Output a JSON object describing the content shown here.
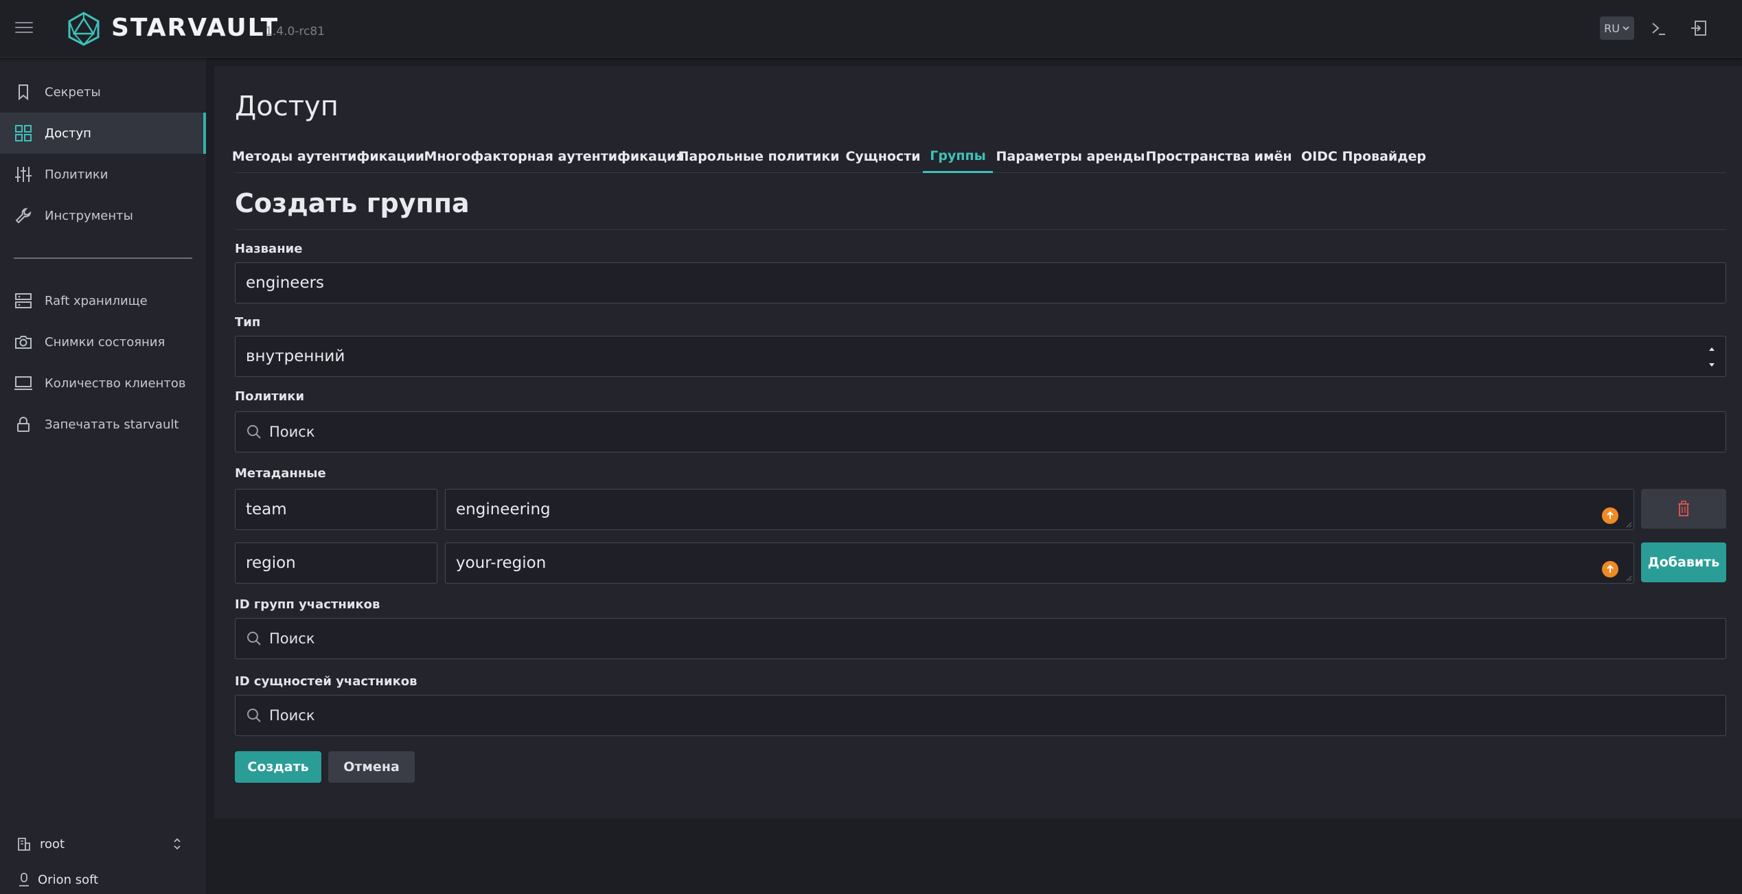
{
  "header": {
    "brand": "STARVAULT",
    "version": "1.4.0-rc81",
    "lang": "RU"
  },
  "sidebar": {
    "items": [
      {
        "label": "Секреты",
        "icon": "bookmark-icon"
      },
      {
        "label": "Доступ",
        "icon": "grid-icon",
        "active": true
      },
      {
        "label": "Политики",
        "icon": "sliders-icon"
      },
      {
        "label": "Инструменты",
        "icon": "wrench-icon"
      }
    ],
    "items2": [
      {
        "label": "Raft хранилище",
        "icon": "server-icon"
      },
      {
        "label": "Снимки состояния",
        "icon": "camera-icon"
      },
      {
        "label": "Количество клиентов",
        "icon": "monitor-icon"
      },
      {
        "label": "Запечатать starvault",
        "icon": "lock-icon"
      }
    ],
    "namespace": "root",
    "org": "Orion soft"
  },
  "main": {
    "title": "Доступ",
    "tabs": [
      {
        "label": "Методы аутентификации"
      },
      {
        "label": "Многофакторная аутентификация"
      },
      {
        "label": "Парольные политики"
      },
      {
        "label": "Сущности"
      },
      {
        "label": "Группы",
        "active": true
      },
      {
        "label": "Параметры аренды"
      },
      {
        "label": "Пространства имён"
      },
      {
        "label": "OIDC Провайдер"
      }
    ],
    "section_title": "Создать группа"
  },
  "form": {
    "name_label": "Название",
    "name_value": "engineers",
    "type_label": "Тип",
    "type_value": "внутренний",
    "policies_label": "Политики",
    "search_placeholder": "Поиск",
    "metadata_label": "Метаданные",
    "metadata": [
      {
        "key": "team",
        "value": "engineering"
      },
      {
        "key": "region",
        "value": "your-region"
      }
    ],
    "add_label": "Добавить",
    "member_groups_label": "ID групп участников",
    "member_entities_label": "ID сущностей участников",
    "create_label": "Создать",
    "cancel_label": "Отмена"
  },
  "colors": {
    "accent": "#3ec1ba",
    "button_primary": "#2a9d97",
    "warning": "#f08a24",
    "danger": "#d9534f"
  }
}
